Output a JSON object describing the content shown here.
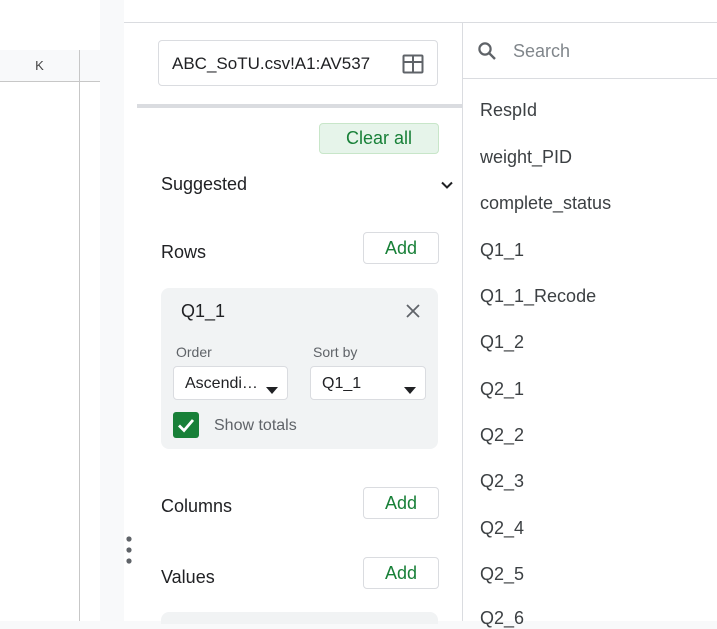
{
  "sheet": {
    "column_header": "K"
  },
  "pivot_editor": {
    "range_value": "ABC_SoTU.csv!A1:AV537",
    "select_range_icon": "grid-icon",
    "clear_all_label": "Clear all",
    "suggested_label": "Suggested",
    "rows_label": "Rows",
    "rows_add_label": "Add",
    "row_field": {
      "title": "Q1_1",
      "order_label": "Order",
      "order_value": "Ascendi…",
      "sort_by_label": "Sort by",
      "sort_by_value": "Q1_1",
      "show_totals_label": "Show totals",
      "show_totals_checked": true
    },
    "columns_label": "Columns",
    "columns_add_label": "Add",
    "values_label": "Values",
    "values_add_label": "Add"
  },
  "field_list": {
    "search_placeholder": "Search",
    "items": [
      "RespId",
      "weight_PID",
      "complete_status",
      "Q1_1",
      "Q1_1_Recode",
      "Q1_2",
      "Q2_1",
      "Q2_2",
      "Q2_3",
      "Q2_4",
      "Q2_5",
      "Q2_6"
    ]
  },
  "colors": {
    "accent_green": "#188038",
    "card_bg": "#f1f3f4",
    "border": "#dadce0"
  }
}
